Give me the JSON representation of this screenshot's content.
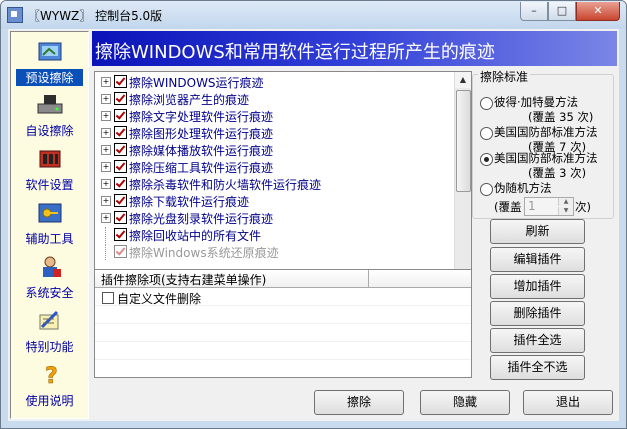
{
  "window": {
    "title": "〖WYWZ〗 控制台5.0版"
  },
  "sidebar": {
    "items": [
      {
        "label": "预设擦除",
        "icon": "preset-icon",
        "selected": true
      },
      {
        "label": "自设擦除",
        "icon": "drive-icon"
      },
      {
        "label": "软件设置",
        "icon": "tools-icon"
      },
      {
        "label": "辅助工具",
        "icon": "key-icon"
      },
      {
        "label": "系统安全",
        "icon": "security-icon"
      },
      {
        "label": "特别功能",
        "icon": "special-icon"
      },
      {
        "label": "使用说明",
        "icon": "help-icon"
      }
    ]
  },
  "banner": {
    "title": "擦除WINDOWS和常用软件运行过程所产生的痕迹"
  },
  "tree": {
    "items": [
      {
        "label": "擦除WINDOWS运行痕迹",
        "expandable": true,
        "checked": true
      },
      {
        "label": "擦除浏览器产生的痕迹",
        "expandable": true,
        "checked": true
      },
      {
        "label": "擦除文字处理软件运行痕迹",
        "expandable": true,
        "checked": true
      },
      {
        "label": "擦除图形处理软件运行痕迹",
        "expandable": true,
        "checked": true
      },
      {
        "label": "擦除媒体播放软件运行痕迹",
        "expandable": true,
        "checked": true
      },
      {
        "label": "擦除压缩工具软件运行痕迹",
        "expandable": true,
        "checked": true
      },
      {
        "label": "擦除杀毒软件和防火墙软件运行痕迹",
        "expandable": true,
        "checked": true
      },
      {
        "label": "擦除下载软件运行痕迹",
        "expandable": true,
        "checked": true
      },
      {
        "label": "擦除光盘刻录软件运行痕迹",
        "expandable": true,
        "checked": true
      },
      {
        "label": "擦除回收站中的所有文件",
        "expandable": false,
        "checked": true
      },
      {
        "label": "擦除Windows系统还原痕迹",
        "expandable": false,
        "checked": true
      }
    ]
  },
  "plugin": {
    "header": "插件擦除项(支持右建菜单操作)",
    "rows": [
      {
        "label": "自定义文件删除",
        "checked": false
      }
    ]
  },
  "standard": {
    "title": "擦除标准",
    "options": [
      {
        "label": "彼得·加特曼方法",
        "note": "(覆盖 35 次)",
        "selected": false
      },
      {
        "label": "美国国防部标准方法",
        "note": "(覆盖 7 次)",
        "selected": false
      },
      {
        "label": "美国国防部标准方法",
        "note": "(覆盖 3 次)",
        "selected": true
      },
      {
        "label": "伪随机方法",
        "note": "",
        "selected": false
      }
    ],
    "custom_prefix": "(覆盖",
    "custom_value": "1",
    "custom_suffix": "次)"
  },
  "side_buttons": [
    "刷新",
    "编辑插件",
    "增加插件",
    "删除插件",
    "插件全选",
    "插件全不选"
  ],
  "bottom_buttons": {
    "erase": "擦除",
    "hide": "隐藏",
    "exit": "退出"
  }
}
